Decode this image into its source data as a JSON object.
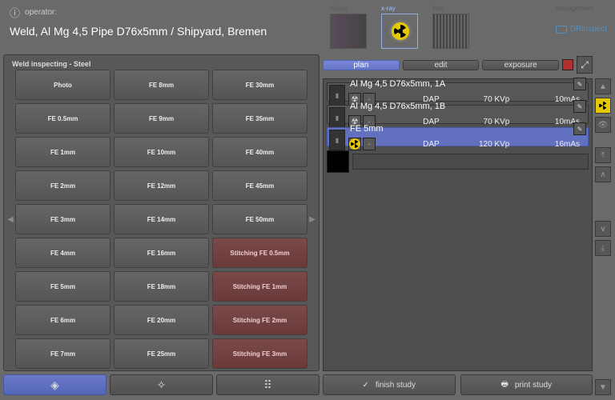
{
  "header": {
    "operator_label": "operator:",
    "weld_title": "Weld, Al Mg 4,5 Pipe D76x5mm / Shipyard, Bremen",
    "tabs": {
      "object": "object",
      "xray": "x-ray",
      "lists": "lists",
      "management": "management"
    },
    "brand": "DRinspect"
  },
  "left": {
    "panel_title": "Weld inspecting - Steel",
    "buttons": [
      {
        "l": "Photo"
      },
      {
        "l": "FE 8mm"
      },
      {
        "l": "FE 30mm"
      },
      {
        "l": "FE 0.5mm"
      },
      {
        "l": "FE 9mm"
      },
      {
        "l": "FE 35mm"
      },
      {
        "l": "FE 1mm"
      },
      {
        "l": "FE 10mm"
      },
      {
        "l": "FE 40mm"
      },
      {
        "l": "FE 2mm"
      },
      {
        "l": "FE 12mm"
      },
      {
        "l": "FE 45mm"
      },
      {
        "l": "FE 3mm"
      },
      {
        "l": "FE 14mm"
      },
      {
        "l": "FE 50mm"
      },
      {
        "l": "FE 4mm"
      },
      {
        "l": "FE 16mm"
      },
      {
        "l": "Stitching FE 0.5mm",
        "r": true
      },
      {
        "l": "FE 5mm"
      },
      {
        "l": "FE 18mm"
      },
      {
        "l": "Stitching FE 1mm",
        "r": true
      },
      {
        "l": "FE 6mm"
      },
      {
        "l": "FE 20mm"
      },
      {
        "l": "Stitching FE 2mm",
        "r": true
      },
      {
        "l": "FE 7mm"
      },
      {
        "l": "FE 25mm"
      },
      {
        "l": "Stitching FE 3mm",
        "r": true
      }
    ]
  },
  "tabs": {
    "plan": "plan",
    "edit": "edit",
    "exposure": "exposure"
  },
  "entries": [
    {
      "title": "Al Mg 4,5 D76x5mm, 1A",
      "dap": "DAP",
      "kvp": "70 KVp",
      "mas": "10mAs",
      "sel": false
    },
    {
      "title": "Al Mg 4,5 D76x5mm, 1B",
      "dap": "DAP",
      "kvp": "70 KVp",
      "mas": "10mAs",
      "sel": false
    },
    {
      "title": "FE 5mm",
      "dap": "DAP",
      "kvp": "120 KVp",
      "mas": "16mAs",
      "sel": true
    }
  ],
  "footer": {
    "finish": "finish study",
    "print": "print study"
  }
}
